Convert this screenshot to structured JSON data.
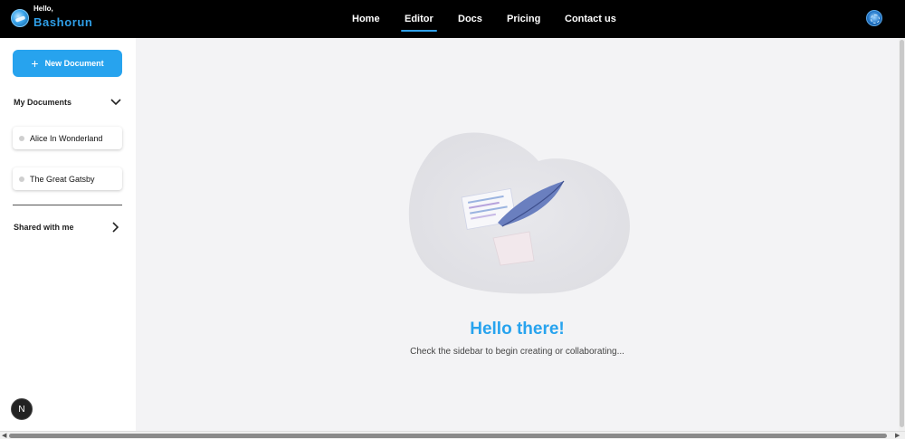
{
  "brand": {
    "greeting": "Hello,",
    "name": "Bashorun"
  },
  "nav": {
    "items": [
      {
        "label": "Home",
        "active": false
      },
      {
        "label": "Editor",
        "active": true
      },
      {
        "label": "Docs",
        "active": false
      },
      {
        "label": "Pricing",
        "active": false
      },
      {
        "label": "Contact us",
        "active": false
      }
    ],
    "accent_color": "#2f9fe8"
  },
  "sidebar": {
    "new_document_label": "New Document",
    "my_documents": {
      "label": "My Documents",
      "expanded": true,
      "items": [
        {
          "title": "Alice In Wonderland"
        },
        {
          "title": "The Great Gatsby"
        }
      ]
    },
    "shared": {
      "label": "Shared with me",
      "expanded": false
    }
  },
  "main": {
    "title": "Hello there!",
    "subtitle": "Check the sidebar to begin creating or collaborating..."
  },
  "badge": {
    "letter": "N"
  },
  "icons": [
    "plus-icon",
    "chevron-down-icon",
    "chevron-right-icon",
    "user-avatar-icon",
    "document-illustration"
  ],
  "colors": {
    "primary": "#27a3ee",
    "header_bg": "#000000",
    "main_bg": "#f3f3f5"
  }
}
